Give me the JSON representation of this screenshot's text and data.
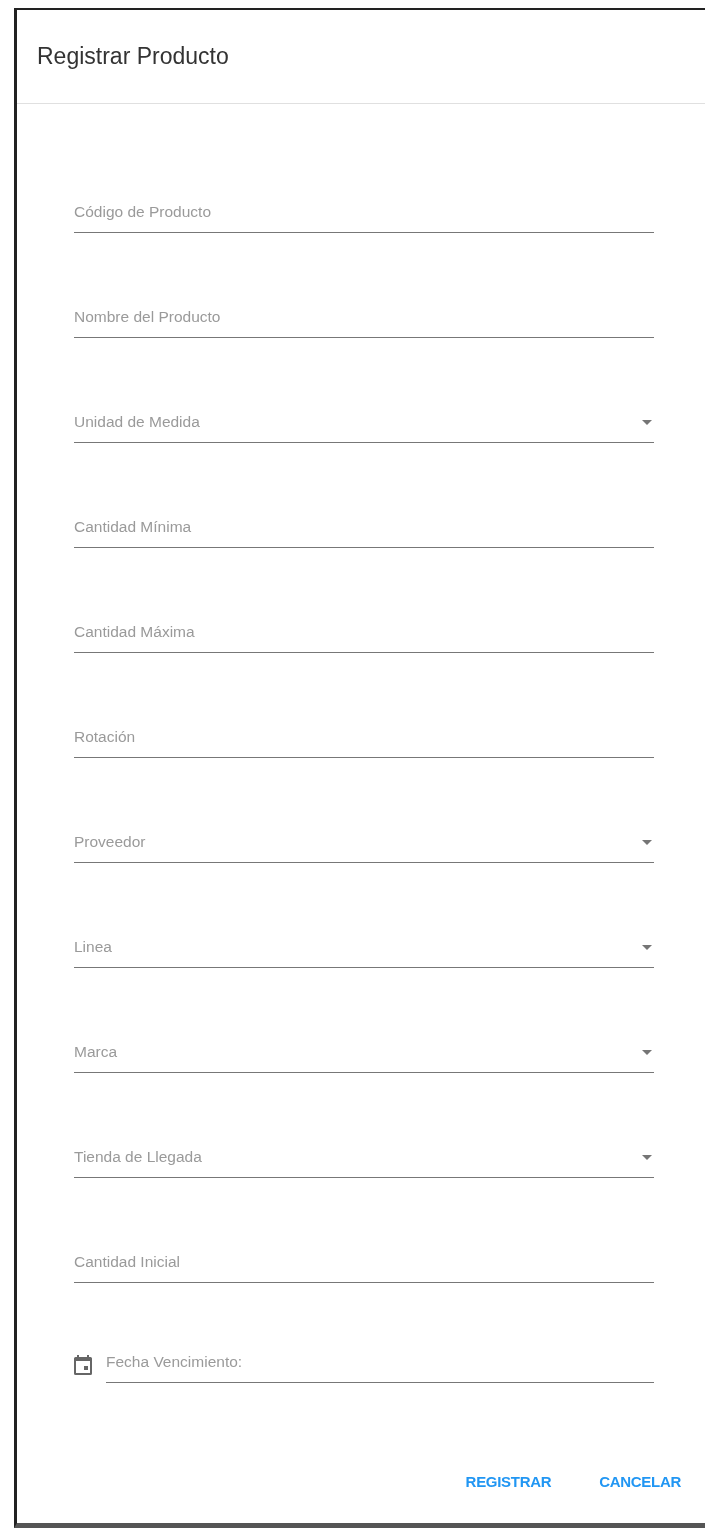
{
  "dialog": {
    "title": "Registrar Producto"
  },
  "fields": [
    {
      "kind": "text",
      "placeholder": "Código de Producto"
    },
    {
      "kind": "text",
      "placeholder": "Nombre del Producto"
    },
    {
      "kind": "select",
      "placeholder": "Unidad de Medida"
    },
    {
      "kind": "text",
      "placeholder": "Cantidad Mínima"
    },
    {
      "kind": "text",
      "placeholder": "Cantidad Máxima"
    },
    {
      "kind": "text",
      "placeholder": "Rotación"
    },
    {
      "kind": "select",
      "placeholder": "Proveedor"
    },
    {
      "kind": "select",
      "placeholder": "Linea"
    },
    {
      "kind": "select",
      "placeholder": "Marca"
    },
    {
      "kind": "select",
      "placeholder": "Tienda de Llegada"
    },
    {
      "kind": "text",
      "placeholder": "Cantidad Inicial"
    },
    {
      "kind": "date",
      "placeholder": "Fecha Vencimiento:"
    }
  ],
  "buttons": [
    "REGISTRAR",
    "CANCELAR"
  ]
}
